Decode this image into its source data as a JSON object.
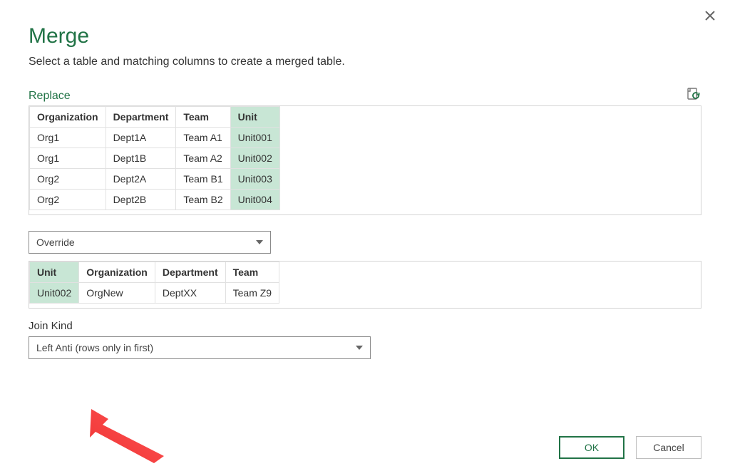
{
  "title": "Merge",
  "intro": "Select a table and matching columns to create a merged table.",
  "table1_label": "Replace",
  "table1": {
    "headers": [
      "Organization",
      "Department",
      "Team",
      "Unit"
    ],
    "selected_col": 3,
    "rows": [
      [
        "Org1",
        "Dept1A",
        "Team A1",
        "Unit001"
      ],
      [
        "Org1",
        "Dept1B",
        "Team A2",
        "Unit002"
      ],
      [
        "Org2",
        "Dept2A",
        "Team B1",
        "Unit003"
      ],
      [
        "Org2",
        "Dept2B",
        "Team B2",
        "Unit004"
      ]
    ]
  },
  "table2_select": "Override",
  "table2": {
    "headers": [
      "Unit",
      "Organization",
      "Department",
      "Team"
    ],
    "selected_col": 0,
    "rows": [
      [
        "Unit002",
        "OrgNew",
        "DeptXX",
        "Team Z9"
      ]
    ]
  },
  "join_label": "Join Kind",
  "join_value": "Left Anti (rows only in first)",
  "buttons": {
    "ok": "OK",
    "cancel": "Cancel"
  }
}
